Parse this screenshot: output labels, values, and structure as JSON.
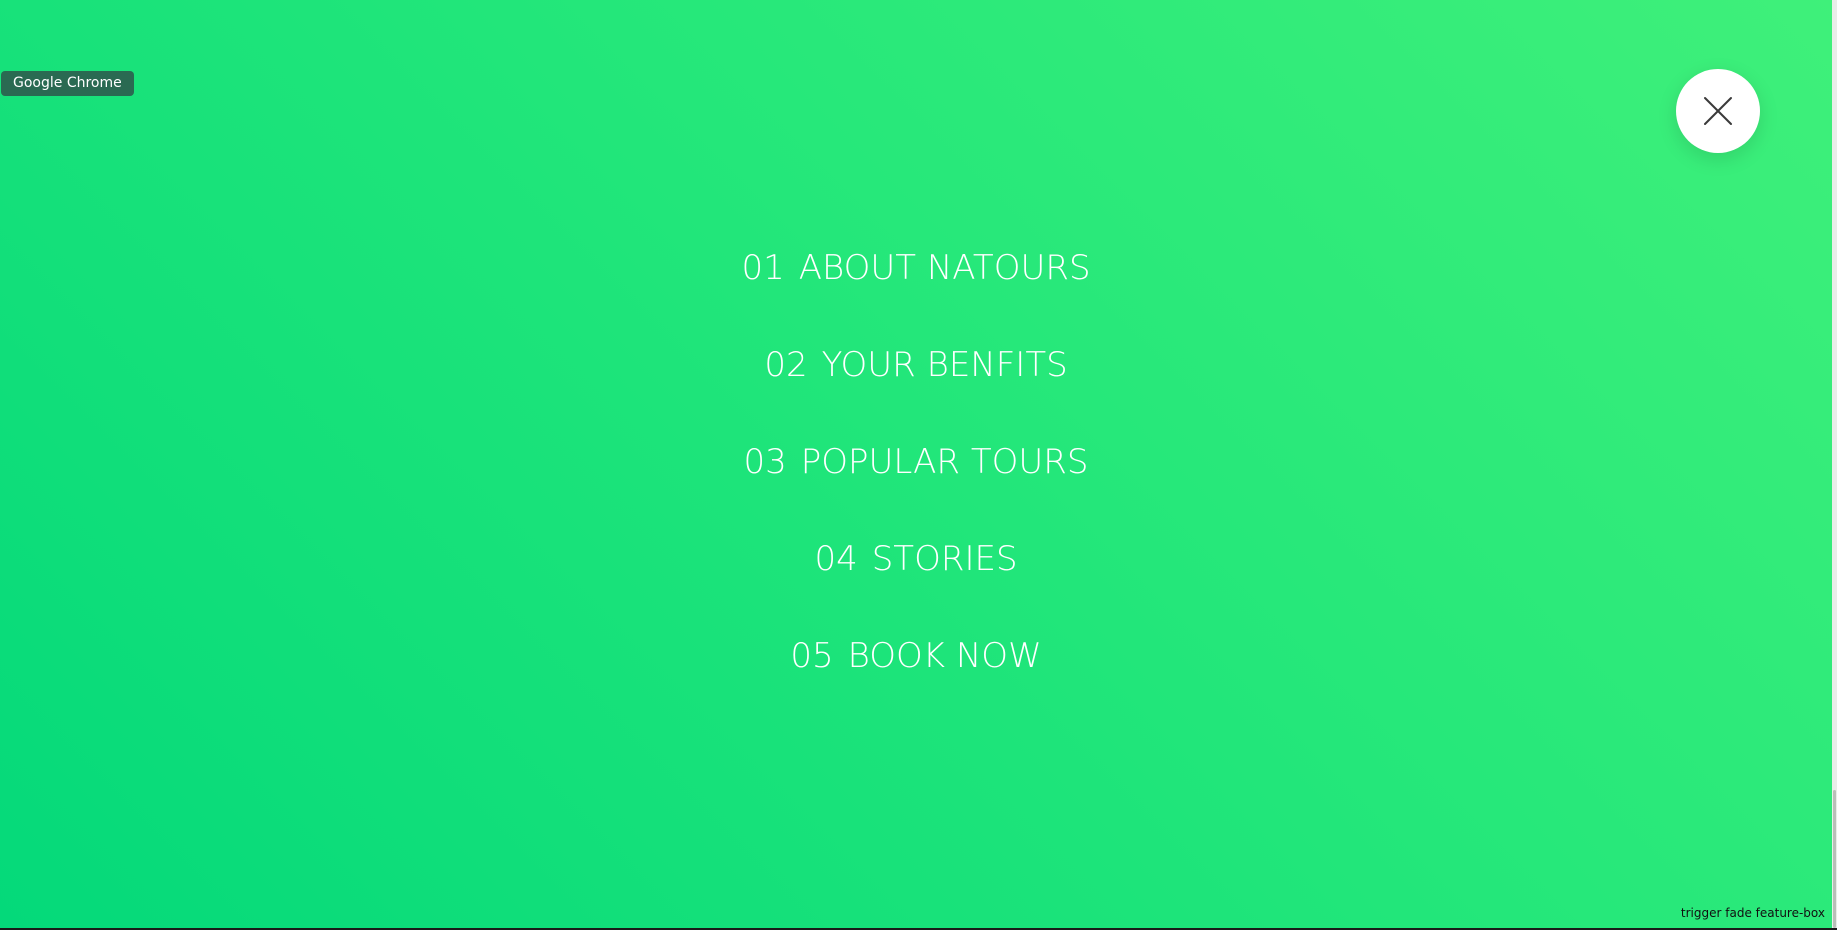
{
  "tooltip": {
    "text": "Google Chrome"
  },
  "close_button": {
    "icon": "close-icon",
    "icon_color": "#3a3a3a"
  },
  "colors": {
    "gradient_start": "#04d97a",
    "gradient_end": "#3ff07a",
    "text": "#ffffff",
    "close_bg": "#ffffff"
  },
  "nav": {
    "items": [
      {
        "number": "01",
        "label": "About Natours"
      },
      {
        "number": "02",
        "label": "Your Benfits"
      },
      {
        "number": "03",
        "label": "Popular Tours"
      },
      {
        "number": "04",
        "label": "Stories"
      },
      {
        "number": "05",
        "label": "Book Now"
      }
    ]
  },
  "status": {
    "text": "trigger fade feature-box"
  }
}
